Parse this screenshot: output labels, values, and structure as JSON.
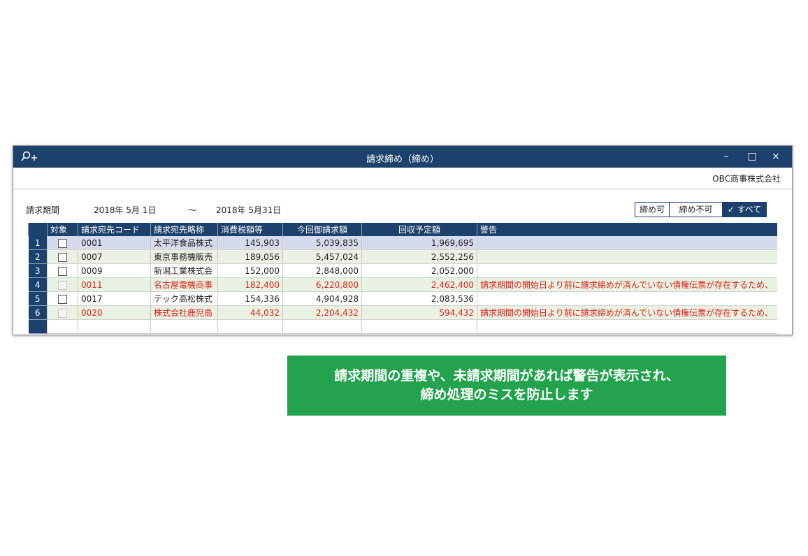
{
  "window": {
    "title": "請求締め（締め）",
    "company": "OBC商事株式会社",
    "controls": {
      "minimize": "–",
      "maximize": "□",
      "close": "×"
    }
  },
  "period": {
    "label": "請求期間",
    "start": "2018年  5月 1日",
    "tilde": "～",
    "end": "2018年  5月31日"
  },
  "filter": {
    "can_close": "締め可",
    "cannot_close": "締め不可",
    "all": "✓ すべて"
  },
  "table": {
    "columns": [
      "",
      "対象",
      "請求宛先コード",
      "請求宛先略称",
      "消費税額等",
      "今回御請求額",
      "回収予定額",
      "警告"
    ],
    "rows": [
      {
        "no": "1",
        "code": "0001",
        "name": "太平洋食品株式",
        "tax": "145,903",
        "amount": "5,039,835",
        "collect": "1,969,695",
        "warning": ""
      },
      {
        "no": "2",
        "code": "0007",
        "name": "東京事務機販売",
        "tax": "189,056",
        "amount": "5,457,024",
        "collect": "2,552,256",
        "warning": ""
      },
      {
        "no": "3",
        "code": "0009",
        "name": "新潟工業株式会",
        "tax": "152,000",
        "amount": "2,848,000",
        "collect": "2,052,000",
        "warning": ""
      },
      {
        "no": "4",
        "code": "0011",
        "name": "名古屋電機商事",
        "tax": "182,400",
        "amount": "6,220,800",
        "collect": "2,462,400",
        "warning": "請求期間の開始日より前に請求締めが済んでいない債権伝票が存在するため、"
      },
      {
        "no": "5",
        "code": "0017",
        "name": "テック高松株式",
        "tax": "154,336",
        "amount": "4,904,928",
        "collect": "2,083,536",
        "warning": ""
      },
      {
        "no": "6",
        "code": "0020",
        "name": "株式会社鹿児島",
        "tax": "44,032",
        "amount": "2,204,432",
        "collect": "594,432",
        "warning": "請求期間の開始日より前に請求締めが済んでいない債権伝票が存在するため、"
      }
    ]
  },
  "banner": {
    "line1": "請求期間の重複や、未請求期間があれば警告が表示され、",
    "line2": "締め処理のミスを防止します"
  },
  "colors": {
    "titlebar": "#1c416d",
    "warning": "#e0201a",
    "banner": "#24a34e",
    "row_alt": "#e9f1e2",
    "row_selected": "#d5dbed"
  }
}
